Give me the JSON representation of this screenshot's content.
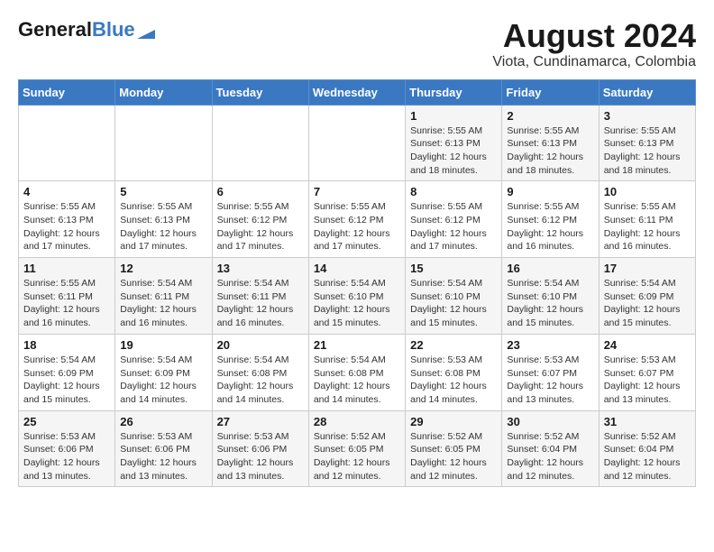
{
  "header": {
    "logo_general": "General",
    "logo_blue": "Blue",
    "title": "August 2024",
    "subtitle": "Viota, Cundinamarca, Colombia"
  },
  "weekdays": [
    "Sunday",
    "Monday",
    "Tuesday",
    "Wednesday",
    "Thursday",
    "Friday",
    "Saturday"
  ],
  "weeks": [
    [
      {
        "day": "",
        "info": ""
      },
      {
        "day": "",
        "info": ""
      },
      {
        "day": "",
        "info": ""
      },
      {
        "day": "",
        "info": ""
      },
      {
        "day": "1",
        "info": "Sunrise: 5:55 AM\nSunset: 6:13 PM\nDaylight: 12 hours\nand 18 minutes."
      },
      {
        "day": "2",
        "info": "Sunrise: 5:55 AM\nSunset: 6:13 PM\nDaylight: 12 hours\nand 18 minutes."
      },
      {
        "day": "3",
        "info": "Sunrise: 5:55 AM\nSunset: 6:13 PM\nDaylight: 12 hours\nand 18 minutes."
      }
    ],
    [
      {
        "day": "4",
        "info": "Sunrise: 5:55 AM\nSunset: 6:13 PM\nDaylight: 12 hours\nand 17 minutes."
      },
      {
        "day": "5",
        "info": "Sunrise: 5:55 AM\nSunset: 6:13 PM\nDaylight: 12 hours\nand 17 minutes."
      },
      {
        "day": "6",
        "info": "Sunrise: 5:55 AM\nSunset: 6:12 PM\nDaylight: 12 hours\nand 17 minutes."
      },
      {
        "day": "7",
        "info": "Sunrise: 5:55 AM\nSunset: 6:12 PM\nDaylight: 12 hours\nand 17 minutes."
      },
      {
        "day": "8",
        "info": "Sunrise: 5:55 AM\nSunset: 6:12 PM\nDaylight: 12 hours\nand 17 minutes."
      },
      {
        "day": "9",
        "info": "Sunrise: 5:55 AM\nSunset: 6:12 PM\nDaylight: 12 hours\nand 16 minutes."
      },
      {
        "day": "10",
        "info": "Sunrise: 5:55 AM\nSunset: 6:11 PM\nDaylight: 12 hours\nand 16 minutes."
      }
    ],
    [
      {
        "day": "11",
        "info": "Sunrise: 5:55 AM\nSunset: 6:11 PM\nDaylight: 12 hours\nand 16 minutes."
      },
      {
        "day": "12",
        "info": "Sunrise: 5:54 AM\nSunset: 6:11 PM\nDaylight: 12 hours\nand 16 minutes."
      },
      {
        "day": "13",
        "info": "Sunrise: 5:54 AM\nSunset: 6:11 PM\nDaylight: 12 hours\nand 16 minutes."
      },
      {
        "day": "14",
        "info": "Sunrise: 5:54 AM\nSunset: 6:10 PM\nDaylight: 12 hours\nand 15 minutes."
      },
      {
        "day": "15",
        "info": "Sunrise: 5:54 AM\nSunset: 6:10 PM\nDaylight: 12 hours\nand 15 minutes."
      },
      {
        "day": "16",
        "info": "Sunrise: 5:54 AM\nSunset: 6:10 PM\nDaylight: 12 hours\nand 15 minutes."
      },
      {
        "day": "17",
        "info": "Sunrise: 5:54 AM\nSunset: 6:09 PM\nDaylight: 12 hours\nand 15 minutes."
      }
    ],
    [
      {
        "day": "18",
        "info": "Sunrise: 5:54 AM\nSunset: 6:09 PM\nDaylight: 12 hours\nand 15 minutes."
      },
      {
        "day": "19",
        "info": "Sunrise: 5:54 AM\nSunset: 6:09 PM\nDaylight: 12 hours\nand 14 minutes."
      },
      {
        "day": "20",
        "info": "Sunrise: 5:54 AM\nSunset: 6:08 PM\nDaylight: 12 hours\nand 14 minutes."
      },
      {
        "day": "21",
        "info": "Sunrise: 5:54 AM\nSunset: 6:08 PM\nDaylight: 12 hours\nand 14 minutes."
      },
      {
        "day": "22",
        "info": "Sunrise: 5:53 AM\nSunset: 6:08 PM\nDaylight: 12 hours\nand 14 minutes."
      },
      {
        "day": "23",
        "info": "Sunrise: 5:53 AM\nSunset: 6:07 PM\nDaylight: 12 hours\nand 13 minutes."
      },
      {
        "day": "24",
        "info": "Sunrise: 5:53 AM\nSunset: 6:07 PM\nDaylight: 12 hours\nand 13 minutes."
      }
    ],
    [
      {
        "day": "25",
        "info": "Sunrise: 5:53 AM\nSunset: 6:06 PM\nDaylight: 12 hours\nand 13 minutes."
      },
      {
        "day": "26",
        "info": "Sunrise: 5:53 AM\nSunset: 6:06 PM\nDaylight: 12 hours\nand 13 minutes."
      },
      {
        "day": "27",
        "info": "Sunrise: 5:53 AM\nSunset: 6:06 PM\nDaylight: 12 hours\nand 13 minutes."
      },
      {
        "day": "28",
        "info": "Sunrise: 5:52 AM\nSunset: 6:05 PM\nDaylight: 12 hours\nand 12 minutes."
      },
      {
        "day": "29",
        "info": "Sunrise: 5:52 AM\nSunset: 6:05 PM\nDaylight: 12 hours\nand 12 minutes."
      },
      {
        "day": "30",
        "info": "Sunrise: 5:52 AM\nSunset: 6:04 PM\nDaylight: 12 hours\nand 12 minutes."
      },
      {
        "day": "31",
        "info": "Sunrise: 5:52 AM\nSunset: 6:04 PM\nDaylight: 12 hours\nand 12 minutes."
      }
    ]
  ]
}
